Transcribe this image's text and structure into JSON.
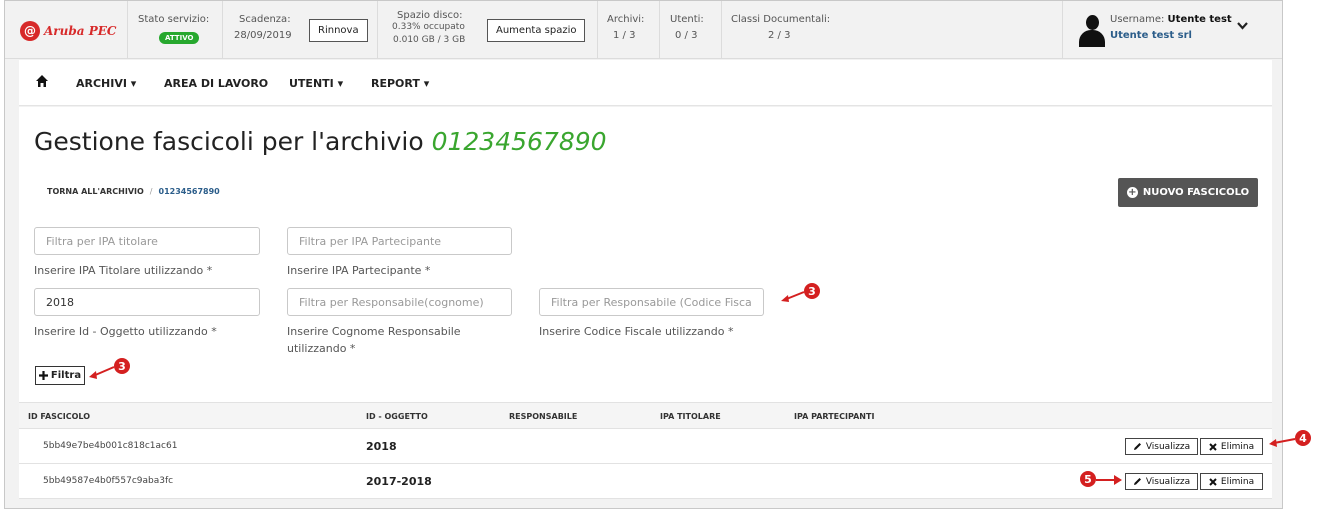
{
  "header": {
    "logo_text": "Aruba PEC",
    "stato_label": "Stato servizio:",
    "stato_badge": "ATTIVO",
    "scadenza_label": "Scadenza:",
    "scadenza_date": "28/09/2019",
    "rinnova_label": "Rinnova",
    "spazio_label": "Spazio disco:",
    "spazio_percent": "0.33% occupato",
    "spazio_size": "0.010 GB / 3 GB",
    "aumenta_label": "Aumenta spazio",
    "archivi_label": "Archivi:",
    "archivi_value": "1 / 3",
    "utenti_label": "Utenti:",
    "utenti_value": "0 / 3",
    "classi_label": "Classi Documentali:",
    "classi_value": "2 / 3",
    "username_label": "Username:",
    "username_value": "Utente test",
    "company": "Utente test srl"
  },
  "nav": {
    "items": [
      "ARCHIVI",
      "AREA DI LAVORO",
      "UTENTI",
      "REPORT"
    ]
  },
  "page": {
    "title_prefix": "Gestione fascicoli per l'archivio",
    "title_code": "01234567890",
    "breadcrumb_back": "TORNA ALL'ARCHIVIO",
    "breadcrumb_sep": "/",
    "breadcrumb_current": "01234567890",
    "new_button": "NUOVO FASCICOLO"
  },
  "filters": {
    "ipa_titolare": {
      "placeholder": "Filtra per IPA titolare",
      "value": "",
      "help": "Inserire IPA Titolare utilizzando *"
    },
    "ipa_partecipante": {
      "placeholder": "Filtra per IPA Partecipante",
      "value": "",
      "help": "Inserire IPA Partecipante *"
    },
    "id_oggetto": {
      "placeholder": "",
      "value": "2018",
      "help": "Inserire Id - Oggetto utilizzando *"
    },
    "resp_cognome": {
      "placeholder": "Filtra per Responsabile(cognome)",
      "value": "",
      "help": "Inserire Cognome Responsabile utilizzando *"
    },
    "resp_cf": {
      "placeholder": "Filtra per Responsabile (Codice Fiscale)",
      "value": "",
      "help": "Inserire Codice Fiscale utilizzando *"
    },
    "filter_button": "Filtra"
  },
  "table": {
    "columns": [
      "ID FASCICOLO",
      "ID - OGGETTO",
      "RESPONSABILE",
      "IPA TITOLARE",
      "IPA PARTECIPANTI"
    ],
    "rows": [
      {
        "id": "5bb49e7be4b001c818c1ac61",
        "oggetto": "2018",
        "responsabile": "",
        "ipa_titolare": "",
        "ipa_partecipanti": ""
      },
      {
        "id": "5bb49587e4b0f557c9aba3fc",
        "oggetto": "2017-2018",
        "responsabile": "",
        "ipa_titolare": "",
        "ipa_partecipanti": ""
      }
    ],
    "view_label": "Visualizza",
    "delete_label": "Elimina"
  },
  "annotations": [
    "3",
    "3",
    "4",
    "5"
  ],
  "colors": {
    "accent_green": "#3aa62f",
    "badge_green": "#27a82e",
    "brand_red": "#d72a2a",
    "annotation_red": "#d42020",
    "button_dark": "#555555"
  },
  "icons": {
    "home": "home-icon",
    "user": "user-icon",
    "chevron": "chevron-down-icon",
    "plus": "plus-icon",
    "pencil": "pencil-icon",
    "times": "times-icon"
  }
}
